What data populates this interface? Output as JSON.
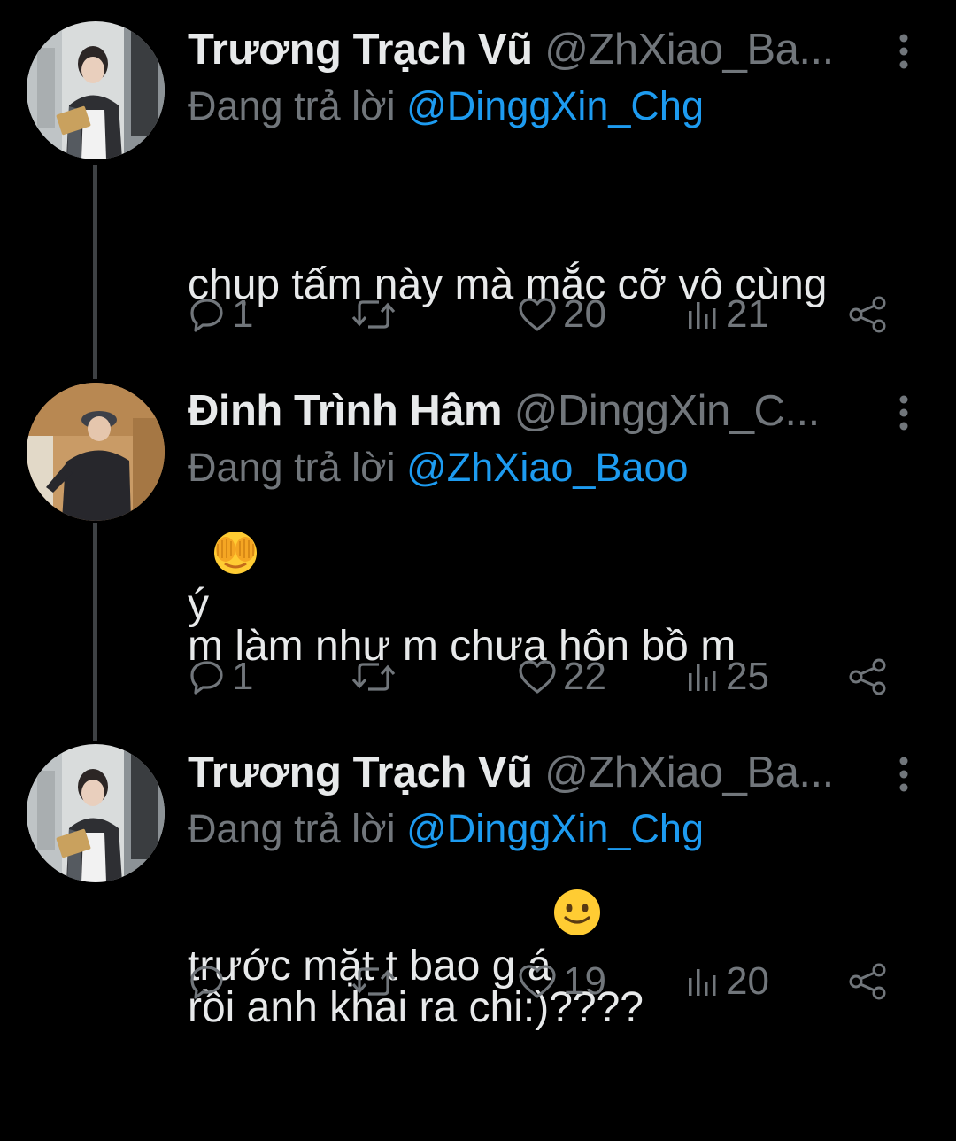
{
  "tweets": [
    {
      "author_name": "Trương Trạch Vũ",
      "handle": "@ZhXiao_Ba...",
      "reply_prefix": "Đang trả lời ",
      "reply_to": "@DinggXin_Chg",
      "text_line1": "chụp tấm này mà mắc cỡ vô cùng",
      "text_line2": "ý",
      "emoji_icon": "face-with-hand-over-eyes-emoji",
      "replies": "1",
      "retweets": "",
      "likes": "20",
      "views": "21"
    },
    {
      "author_name": "Đinh Trình Hâm",
      "handle": "@DinggXin_C...",
      "reply_prefix": "Đang trả lời ",
      "reply_to": "@ZhXiao_Baoo",
      "text_line1": "m làm như m chưa hôn bồ m",
      "text_line2": "trước mặt t bao g á",
      "emoji_icon": "slightly-smiling-face-emoji",
      "replies": "1",
      "retweets": "",
      "likes": "22",
      "views": "25"
    },
    {
      "author_name": "Trương Trạch Vũ",
      "handle": "@ZhXiao_Ba...",
      "reply_prefix": "Đang trả lời ",
      "reply_to": "@DinggXin_Chg",
      "text_line1": "rồi anh khai ra chi:)????",
      "replies": "",
      "retweets": "",
      "likes": "19",
      "views": "20"
    }
  ],
  "colors": {
    "background": "#000000",
    "text_primary": "#e7e9ea",
    "text_secondary": "#71767b",
    "mention": "#1d9bf0",
    "thread_line": "#3e4144"
  },
  "icons": {
    "reply": "reply-icon",
    "retweet": "retweet-icon",
    "like": "heart-icon",
    "views": "views-icon",
    "share": "share-icon",
    "more": "more-vertical-icon"
  }
}
